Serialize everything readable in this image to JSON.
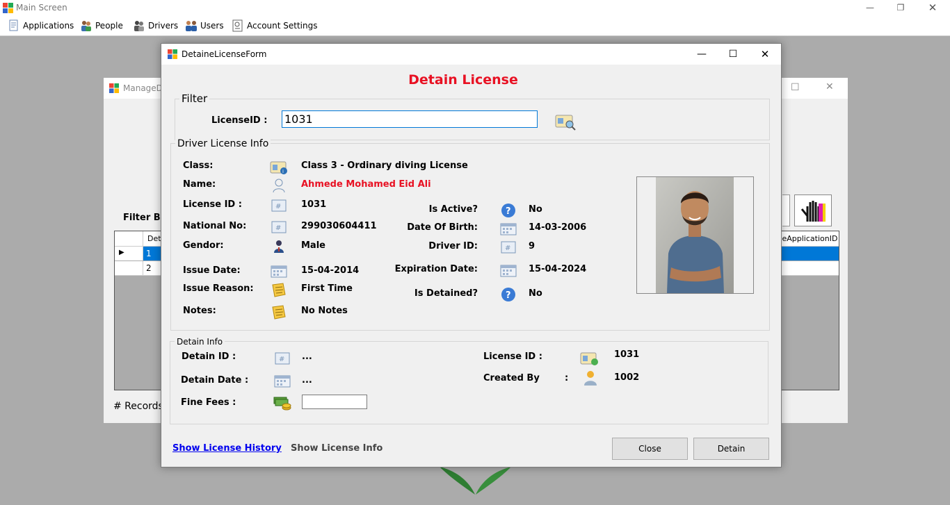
{
  "main_window": {
    "title": "Main Screen",
    "menu": [
      {
        "label": "Applications",
        "icon": "applications-icon"
      },
      {
        "label": "People",
        "icon": "people-icon"
      },
      {
        "label": "Drivers",
        "icon": "drivers-icon"
      },
      {
        "label": "Users",
        "icon": "users-icon"
      },
      {
        "label": "Account Settings",
        "icon": "account-settings-icon"
      }
    ]
  },
  "background_window": {
    "title": "ManageDe",
    "filter_label": "Filter By",
    "grid_header_first": "Deta",
    "grid_header_last": "aseApplicationID",
    "rows": [
      "1",
      "2"
    ],
    "records_label": "# Records"
  },
  "dialog": {
    "title": "DetaineLicenseForm",
    "heading": "Detain License",
    "filter": {
      "group_title": "Filter",
      "license_id_label": "LicenseID  :",
      "license_id_value": "1031"
    },
    "driver_license_info": {
      "group_title": "Driver License Info",
      "class_label": "Class:",
      "class_value": "Class 3 - Ordinary diving License",
      "name_label": "Name:",
      "name_value": "Ahmede Mohamed Eid Ali",
      "license_id_label": "License ID :",
      "license_id_value": "1031",
      "national_no_label": "National No:",
      "national_no_value": "299030604411",
      "gendor_label": "Gendor:",
      "gendor_value": "Male",
      "issue_date_label": "Issue Date:",
      "issue_date_value": "15-04-2014",
      "issue_reason_label": "Issue Reason:",
      "issue_reason_value": "First Time",
      "notes_label": "Notes:",
      "notes_value": "No Notes",
      "is_active_label": "Is Active?",
      "is_active_value": "No",
      "dob_label": "Date Of Birth:",
      "dob_value": "14-03-2006",
      "driver_id_label": "Driver ID:",
      "driver_id_value": "9",
      "expiration_label": "Expiration Date:",
      "expiration_value": "15-04-2024",
      "is_detained_label": "Is Detained?",
      "is_detained_value": "No"
    },
    "detain_info": {
      "group_title": "Detain Info",
      "detain_id_label": "Detain ID  :",
      "detain_id_value": "...",
      "detain_date_label": "Detain Date  :",
      "detain_date_value": "...",
      "fine_fees_label": "Fine Fees  :",
      "fine_fees_value": "",
      "license_id_label": "License ID :",
      "license_id_value": "1031",
      "created_by_label": "Created By",
      "created_by_colon": ":",
      "created_by_value": "1002"
    },
    "links": {
      "history": "Show License History",
      "info": "Show License Info"
    },
    "buttons": {
      "close": "Close",
      "detain": "Detain"
    }
  },
  "colors": {
    "heading_red": "#e81123",
    "name_red": "#e81123",
    "link_blue": "#0000ee",
    "selection_blue": "#0078d7"
  }
}
